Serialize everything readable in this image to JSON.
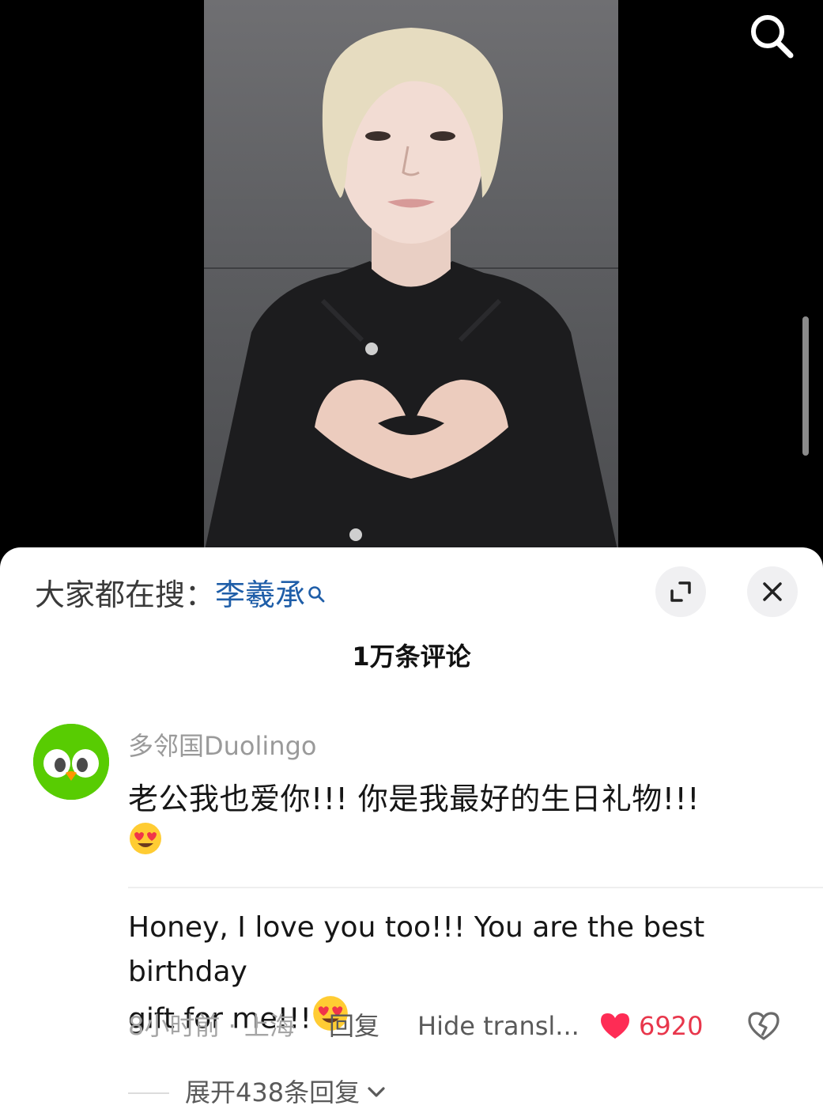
{
  "video": {
    "search_icon": "search-icon",
    "background": "#000000"
  },
  "sheet": {
    "trending_prefix": "大家都在搜：",
    "trending_keyword": "李羲承",
    "keyword_color": "#1f5ea8",
    "expand_icon": "expand-icon",
    "close_icon": "close-icon",
    "comment_count": "1万条评论"
  },
  "comment": {
    "username": "多邻国Duolingo",
    "text": "老公我也爱你!!!  你是我最好的生日礼物!!!",
    "translation_line1": "Honey, I love you too!!! You are the best birthday",
    "translation_line2": "gift for me!!!",
    "time_location": "8小时前 · 上海",
    "reply_label": "回复",
    "hide_translation_label": "Hide transl...",
    "like_count": "6920",
    "like_color": "#e8364b",
    "liked": true,
    "expand_replies_label": "展开438条回复",
    "emoji": "heart-eyes-emoji"
  }
}
